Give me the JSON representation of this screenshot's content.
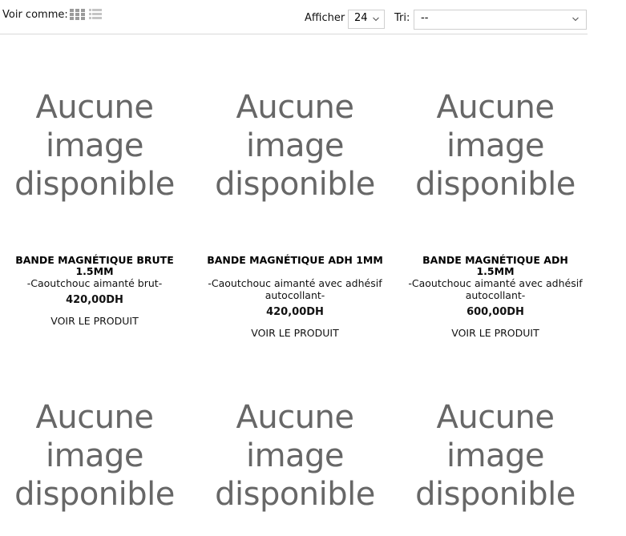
{
  "toolbar": {
    "view_as_label": "Voir comme:",
    "view_icons": [
      "grid-icon",
      "list-icon"
    ],
    "show_label": "Afficher",
    "show_value": "24",
    "sort_label": "Tri:",
    "sort_value": "--"
  },
  "placeholder": {
    "line1": "Aucune",
    "line2": "image",
    "line3": "disponible"
  },
  "products": [
    {
      "name": "BANDE MAGNÉTIQUE BRUTE 1.5MM",
      "desc": "-Caoutchouc aimanté brut-",
      "price": "420,00DH",
      "link": "VOIR LE PRODUIT"
    },
    {
      "name": "BANDE MAGNÉTIQUE ADH 1MM",
      "desc": "-Caoutchouc aimanté avec adhésif autocollant-",
      "price": "420,00DH",
      "link": "VOIR LE PRODUIT"
    },
    {
      "name": "BANDE MAGNÉTIQUE ADH 1.5MM",
      "desc": "-Caoutchouc aimanté avec adhésif autocollant-",
      "price": "600,00DH",
      "link": "VOIR LE PRODUIT"
    }
  ],
  "colors": {
    "placeholder_text": "#676767",
    "divider": "#d9d9d9"
  }
}
